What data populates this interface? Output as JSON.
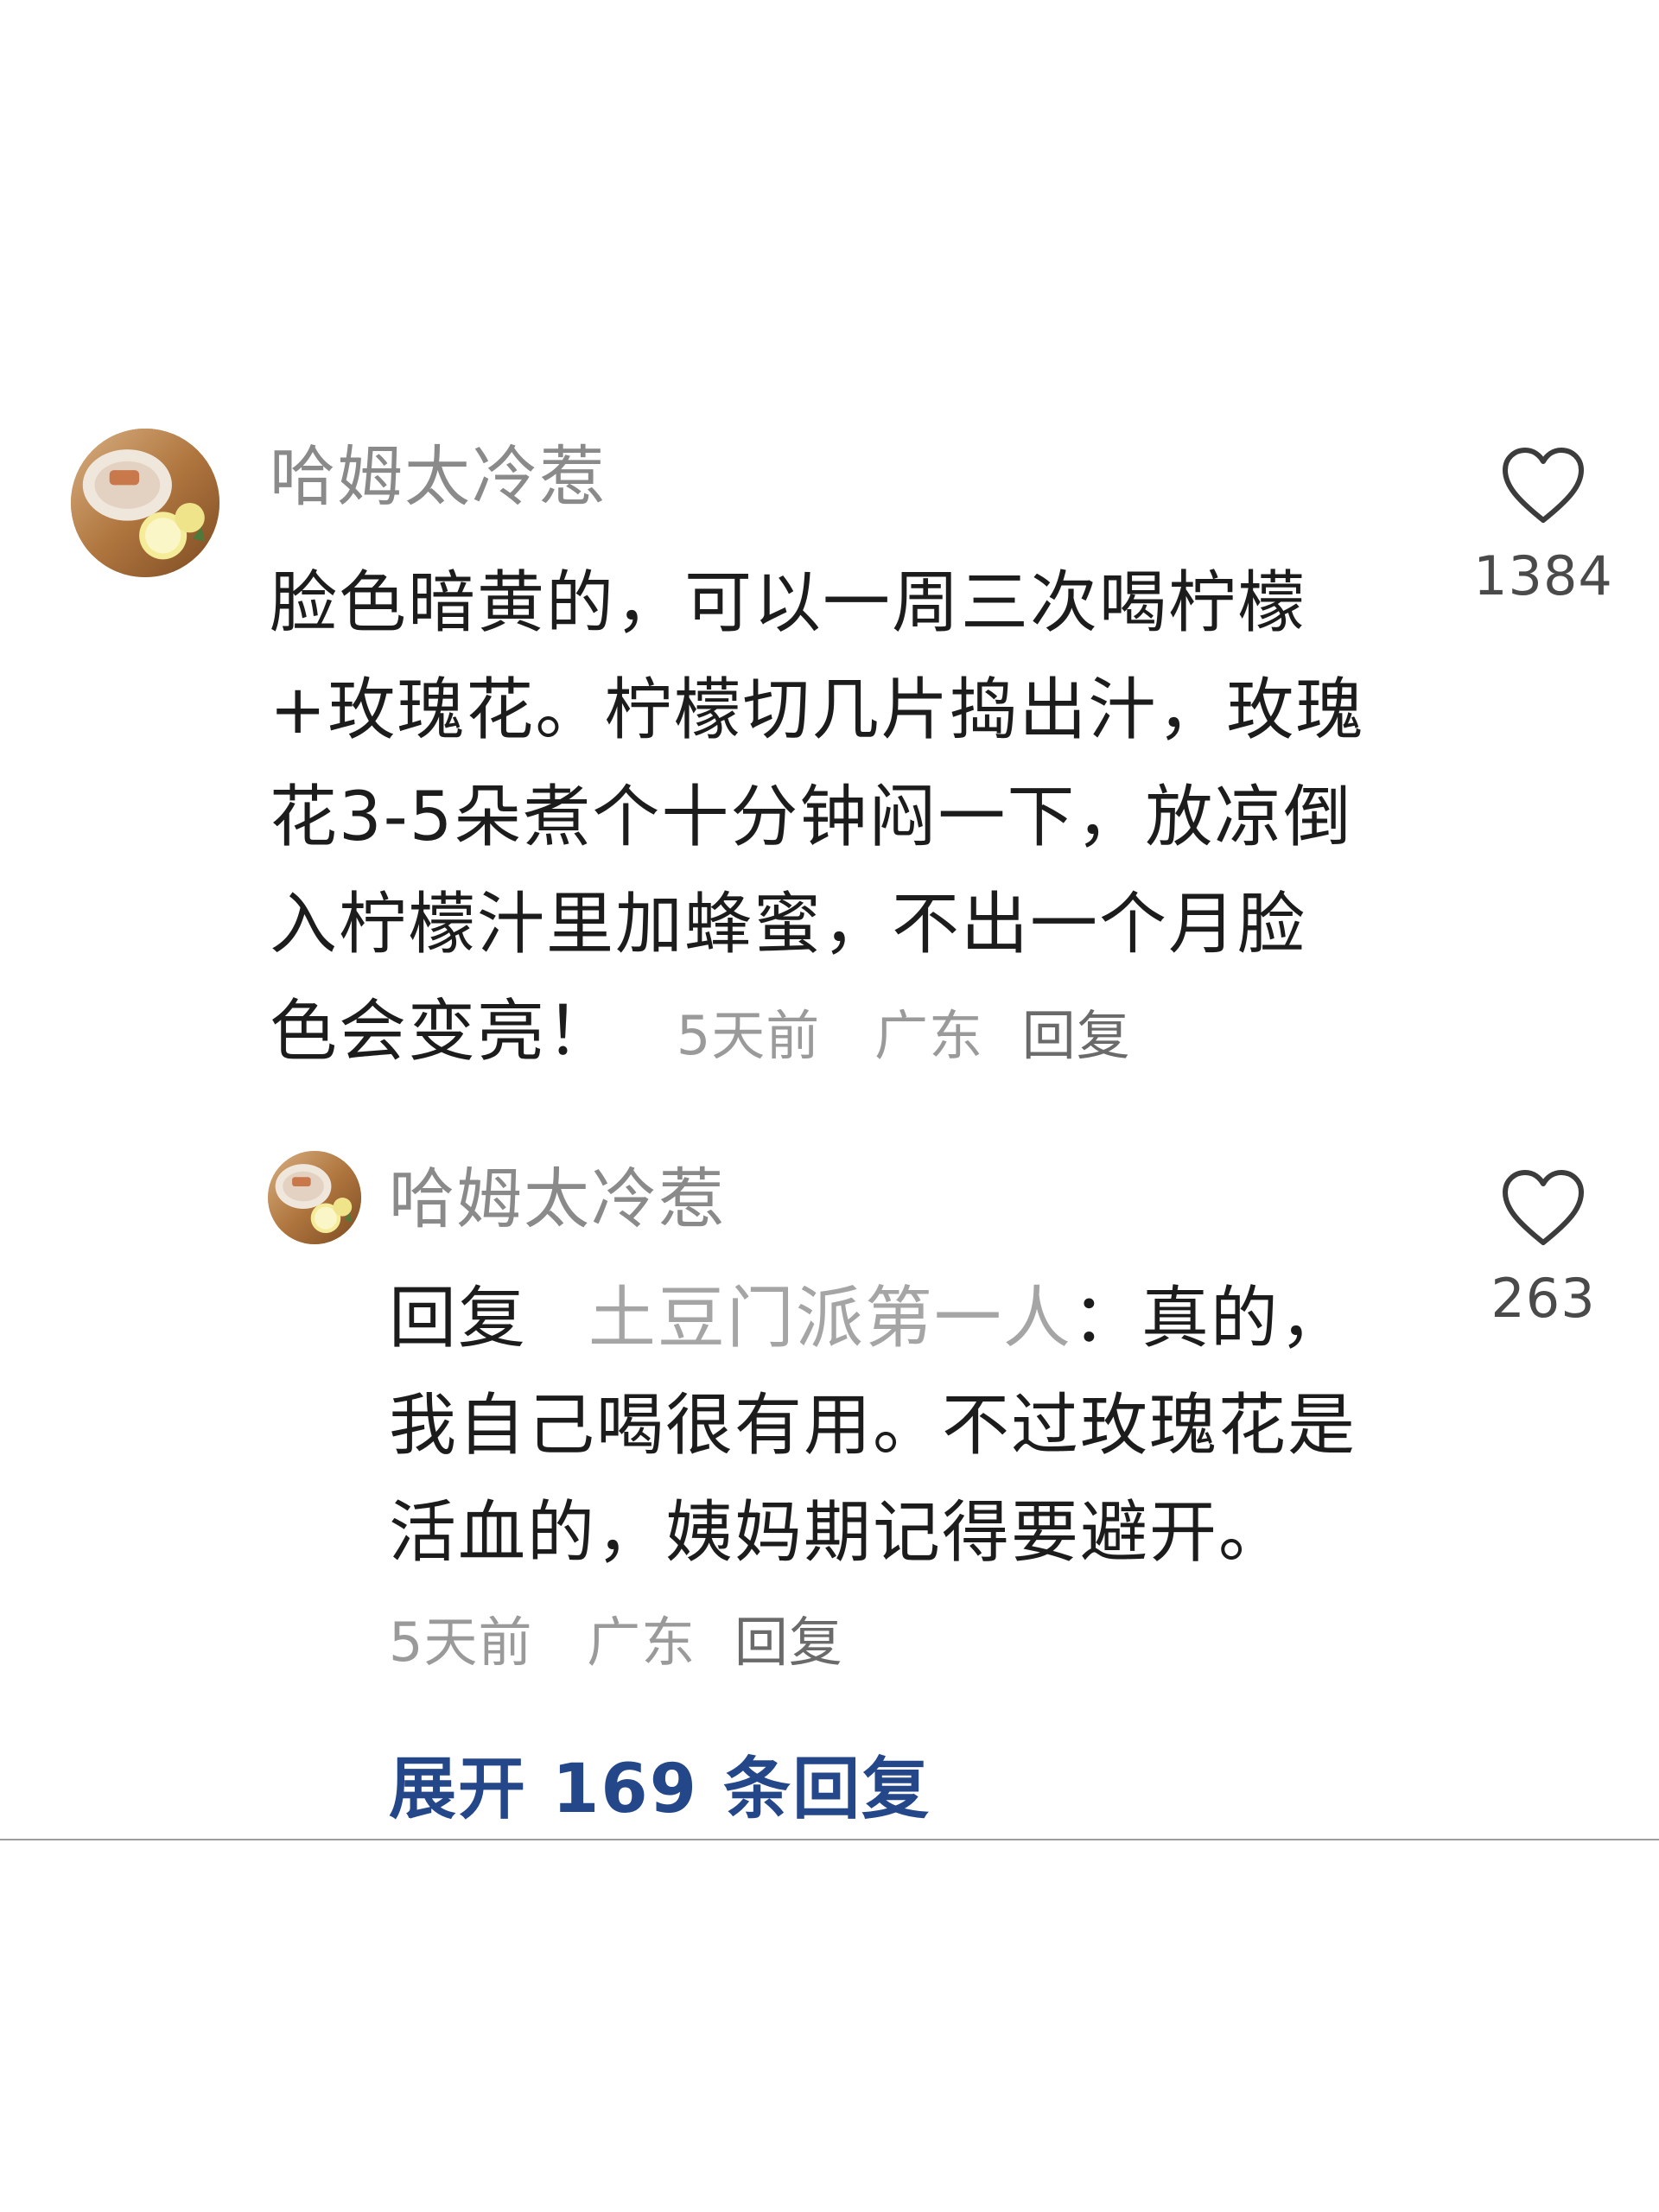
{
  "main_comment": {
    "username": "哈姆太冷惹",
    "text": "脸色暗黄的，可以一周三次喝柠檬+玫瑰花。柠檬切几片捣出汁，玫瑰花3-5朵煮个十分钟闷一下，放凉倒入柠檬汁里加蜂蜜，不出一个月脸色会变亮！",
    "lines": [
      "脸色暗黄的，可以一周三次喝柠檬",
      "+玫瑰花。柠檬切几片捣出汁，玫瑰",
      "花3-5朵煮个十分钟闷一下，放凉倒",
      "入柠檬汁里加蜂蜜，不出一个月脸",
      "色会变亮！"
    ],
    "time": "5天前",
    "location": "广东",
    "reply_label": "回复",
    "like_count": "1384",
    "like_icon": "heart-outline-icon"
  },
  "reply_comment": {
    "username": "哈姆太冷惹",
    "reply_prefix": "回复",
    "reply_target": "土豆门派第一人",
    "lines": [
      "：真的，",
      "我自己喝很有用。不过玫瑰花是",
      "活血的，姨妈期记得要避开。"
    ],
    "time": "5天前",
    "location": "广东",
    "reply_label": "回复",
    "like_count": "263",
    "like_icon": "heart-outline-icon"
  },
  "expand_replies": {
    "label": "展开 169 条回复"
  },
  "colors": {
    "link_blue": "#24478a",
    "username_gray": "#8a8a8a",
    "meta_gray": "#9a9a9a",
    "text_dark": "#1c1c1c"
  }
}
